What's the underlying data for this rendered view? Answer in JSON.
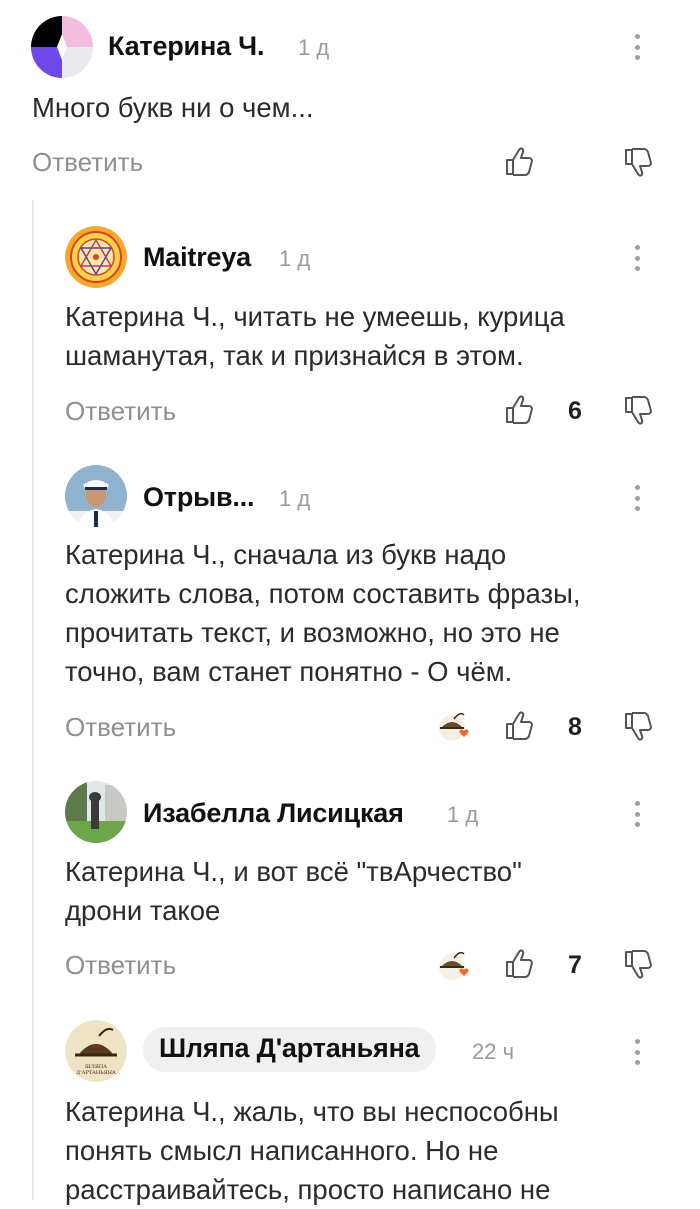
{
  "colors": {
    "text": "#2b2b2b",
    "muted": "#8f8f8f",
    "icon": "#555555",
    "reaction_heart": "#f06a1f",
    "author_pill": "#f0f0f0",
    "thread_line": "#e6e6e6"
  },
  "comments": [
    {
      "author": "Катерина Ч.",
      "time": "1 д",
      "text": "Много букв ни о чем...",
      "reply_label": "Ответить",
      "likes": null,
      "avatar_icon": "geometric-avatar"
    },
    {
      "author": "Maitreya",
      "time": "1 д",
      "text": "Катерина Ч., читать не умеешь, курица\nшаманутая, так и признайся в этом.",
      "reply_label": "Ответить",
      "likes": "6",
      "avatar_icon": "mandala-avatar"
    },
    {
      "author": "Отрыв...",
      "time": "1 д",
      "text": "Катерина Ч., сначала из букв надо\nсложить слова, потом составить фразы,\nпрочитать текст, и возможно, но это не\nточно, вам станет понятно - О чём.",
      "reply_label": "Ответить",
      "likes": "8",
      "avatar_icon": "officer-photo-avatar",
      "reaction_icon": "author-hat-heart-reaction"
    },
    {
      "author": "Изабелла Лисицкая",
      "time": "1 д",
      "text": "Катерина Ч., и вот всё \"твАрчество\"\nдрони такое",
      "reply_label": "Ответить",
      "likes": "7",
      "avatar_icon": "park-photo-avatar",
      "reaction_icon": "author-hat-heart-reaction"
    },
    {
      "author": "Шляпа Д'артаньяна",
      "time": "22 ч",
      "text": "Катерина Ч., жаль, что вы неспособны\nпонять смысл написанного. Но не\nрасстраивайтесь, просто написано не",
      "avatar_icon": "hat-logo-avatar",
      "avatar_logo_text": "ШЛЯПА Д'АРТАНЬЯНА",
      "author_highlighted": true
    }
  ]
}
